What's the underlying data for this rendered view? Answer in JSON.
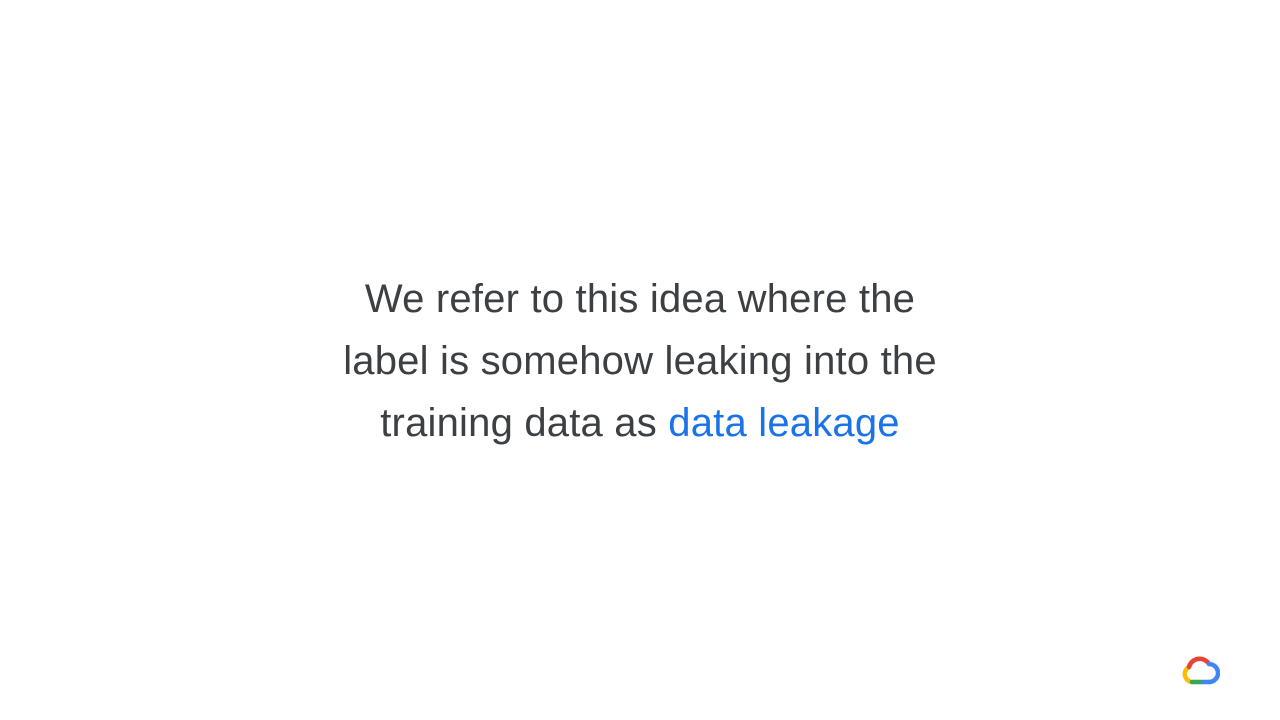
{
  "slide": {
    "lines": [
      "We refer to this idea where the",
      "label is somehow leaking into the",
      "training data as "
    ],
    "highlight_text": "data leakage"
  },
  "colors": {
    "text": "#3c4043",
    "highlight": "#1a73e8",
    "background": "#ffffff"
  },
  "logo": {
    "icon": "google-cloud-logo-icon"
  }
}
